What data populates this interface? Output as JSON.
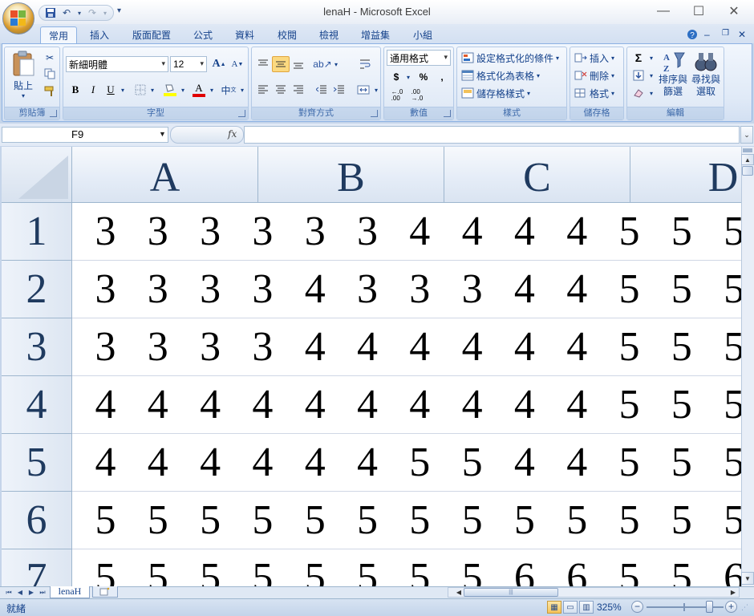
{
  "window": {
    "title": "lenaH - Microsoft Excel"
  },
  "ribbon": {
    "tabs": [
      "常用",
      "插入",
      "版面配置",
      "公式",
      "資料",
      "校閱",
      "檢視",
      "增益集",
      "小組"
    ],
    "active_tab": "常用",
    "clipboard": {
      "paste_label": "貼上",
      "group_label": "剪貼簿"
    },
    "font": {
      "font_name": "新細明體",
      "font_size": "12",
      "group_label": "字型",
      "bold": "B",
      "italic": "I",
      "underline": "U"
    },
    "alignment": {
      "group_label": "對齊方式"
    },
    "number": {
      "format": "通用格式",
      "currency": "$",
      "percent": "%",
      "comma": ",",
      "group_label": "數值"
    },
    "styles": {
      "conditional": "設定格式化的條件",
      "as_table": "格式化為表格",
      "cell_styles": "儲存格樣式",
      "group_label": "樣式"
    },
    "cells": {
      "insert": "插入",
      "delete": "刪除",
      "format": "格式",
      "group_label": "儲存格"
    },
    "editing": {
      "sort_filter": "排序與\n篩選",
      "find_select": "尋找與\n選取",
      "sum": "Σ",
      "group_label": "編輯"
    }
  },
  "formula_bar": {
    "name_box": "F9",
    "fx": "fx",
    "content": ""
  },
  "grid": {
    "column_headers": [
      "A",
      "B",
      "C",
      "D"
    ],
    "row_headers": [
      "1",
      "2",
      "3",
      "4",
      "5",
      "6",
      "7"
    ],
    "rows": [
      [
        "3",
        "3",
        "3",
        "3",
        "3",
        "3",
        "4",
        "4",
        "4",
        "4",
        "5",
        "5",
        "5"
      ],
      [
        "3",
        "3",
        "3",
        "3",
        "4",
        "3",
        "3",
        "3",
        "4",
        "4",
        "5",
        "5",
        "5"
      ],
      [
        "3",
        "3",
        "3",
        "3",
        "4",
        "4",
        "4",
        "4",
        "4",
        "4",
        "5",
        "5",
        "5"
      ],
      [
        "4",
        "4",
        "4",
        "4",
        "4",
        "4",
        "4",
        "4",
        "4",
        "4",
        "5",
        "5",
        "5"
      ],
      [
        "4",
        "4",
        "4",
        "4",
        "4",
        "4",
        "5",
        "5",
        "4",
        "4",
        "5",
        "5",
        "5"
      ],
      [
        "5",
        "5",
        "5",
        "5",
        "5",
        "5",
        "5",
        "5",
        "5",
        "5",
        "5",
        "5",
        "5"
      ],
      [
        "5",
        "5",
        "5",
        "5",
        "5",
        "5",
        "5",
        "5",
        "6",
        "6",
        "5",
        "5",
        "6"
      ]
    ]
  },
  "sheets": {
    "tabs": [
      "lenaH"
    ],
    "active": "lenaH"
  },
  "status": {
    "text": "就緒",
    "zoom": "325%"
  },
  "colors": {
    "ribbon_text": "#15428b",
    "header_text": "#1f3a5f",
    "font_color_underline": "#e00000",
    "highlight_color": "#ffff00"
  }
}
